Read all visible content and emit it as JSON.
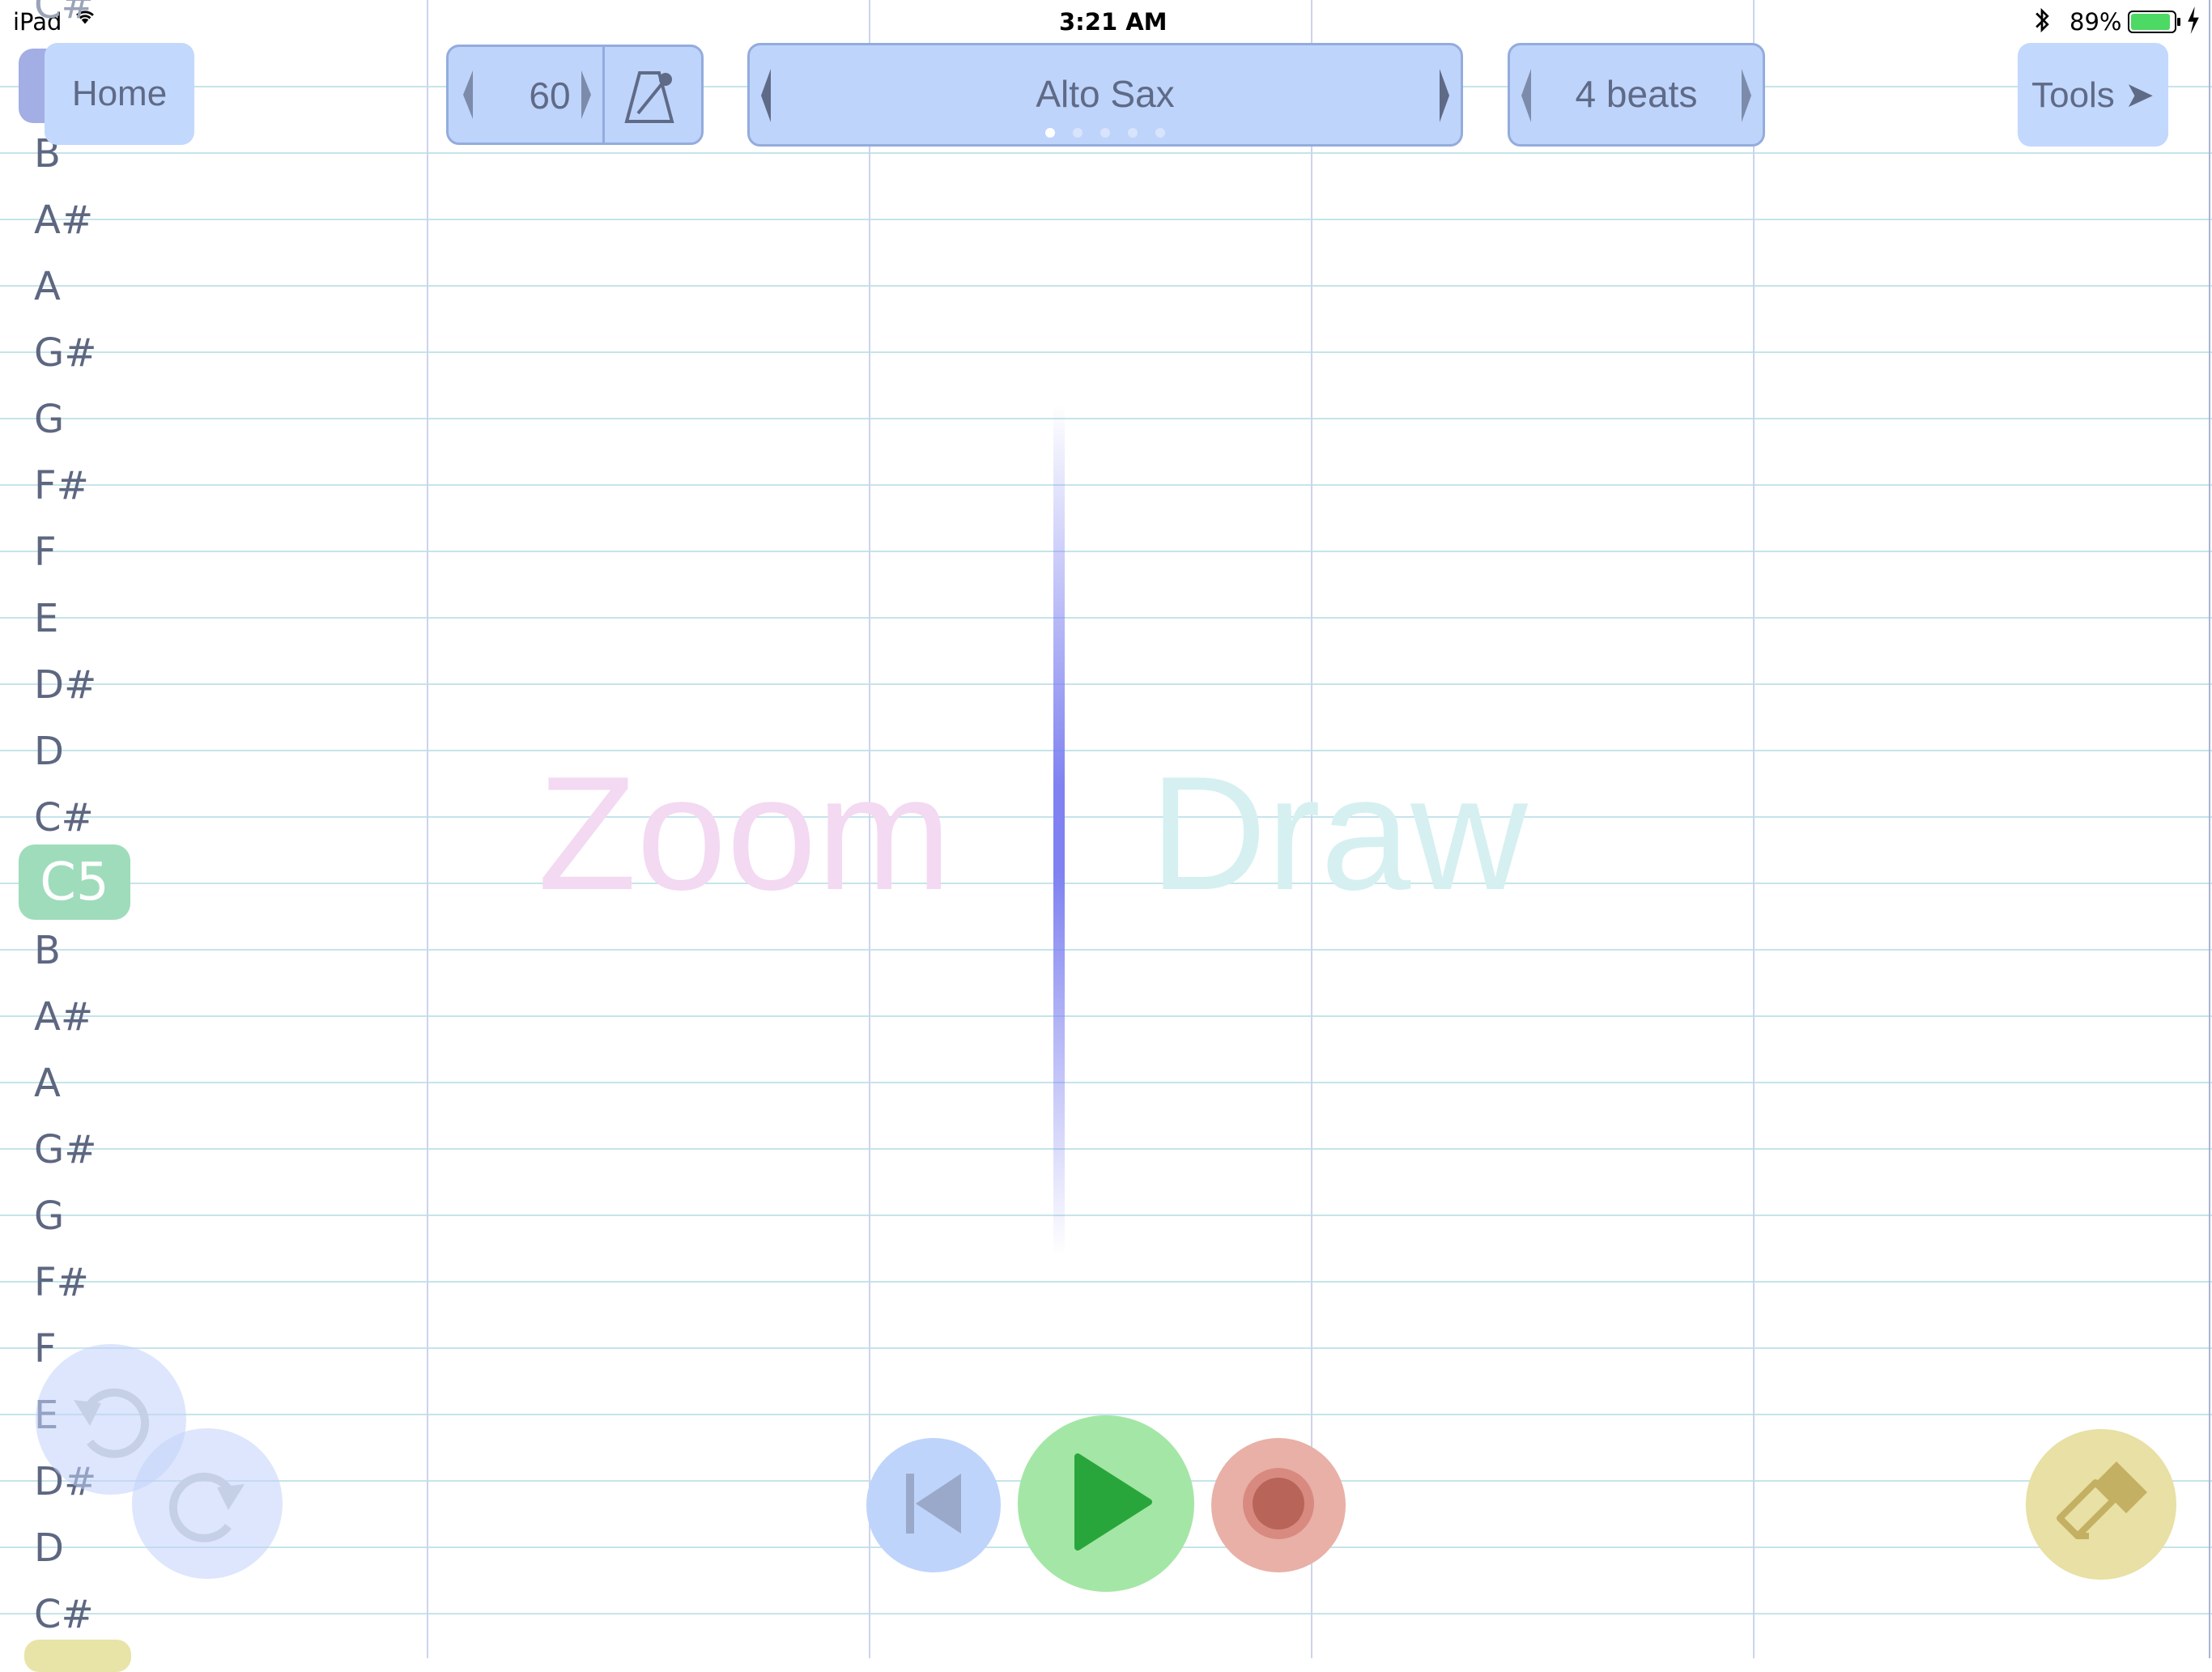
{
  "status_bar": {
    "device": "iPad",
    "time": "3:21 AM",
    "battery": "89%"
  },
  "toolbar": {
    "home_label": "Home",
    "tempo_value": "60",
    "instrument": "Alto Sax",
    "instrument_page_count": 5,
    "instrument_page_index": 0,
    "beats": "4 beats",
    "tools_label": "Tools ➤"
  },
  "piano_roll": {
    "notes": [
      "B",
      "A#",
      "A",
      "G#",
      "G",
      "F#",
      "F",
      "E",
      "D#",
      "D",
      "C#",
      "C5",
      "B",
      "A#",
      "A",
      "G#",
      "G",
      "F#",
      "F",
      "E",
      "D#",
      "D",
      "C#"
    ],
    "highlighted_note": "C5",
    "partial_top_label": "C#"
  },
  "canvas": {
    "left_hint": "Zoom",
    "right_hint": "Draw"
  },
  "icons": {
    "undo": "undo-icon",
    "redo": "redo-icon",
    "rewind": "skip-to-start-icon",
    "play": "play-icon",
    "record": "record-icon",
    "eraser": "eraser-icon",
    "metronome": "metronome-icon"
  },
  "colors": {
    "zoom_hint": "#f3d9f2",
    "draw_hint": "#d6f0f1",
    "playhead": "#7f82f0",
    "c5_badge": "#9fdcbb",
    "play_button": "#a4e6a6",
    "record_button": "#e8b0a6",
    "eraser_button": "#e8e0a4"
  }
}
